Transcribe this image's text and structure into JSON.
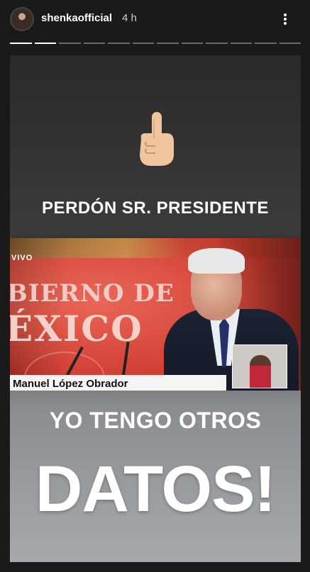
{
  "header": {
    "username": "shenkaofficial",
    "timestamp": "4 h",
    "more_icon": "more-horizontal-icon"
  },
  "progress": {
    "segment_count": 12,
    "completed": 2
  },
  "story": {
    "emoji": "index-pointing-up-icon",
    "caption_top": "PERDÓN SR. PRESIDENTE",
    "tv": {
      "live_label": "VIVO",
      "background_line1": "BIERNO DE",
      "background_line2": "ÉXICO",
      "lower_third": "Manuel López Obrador"
    },
    "caption_middle": "YO TENGO OTROS",
    "caption_big": "DATOS!"
  },
  "colors": {
    "tv_red": "#cf3b30",
    "background": "#1a1a1a"
  }
}
